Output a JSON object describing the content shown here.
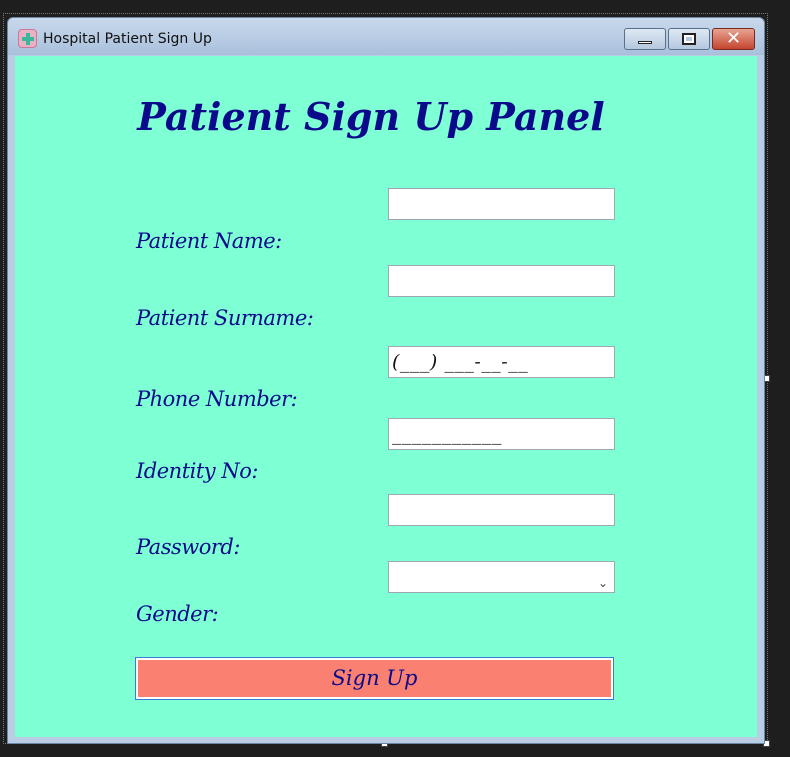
{
  "window": {
    "title": "Hospital Patient Sign Up",
    "icon": "hospital-icon"
  },
  "form": {
    "heading": "Patient Sign Up Panel",
    "fields": {
      "name_label": "Patient Name:",
      "name_value": "",
      "surname_label": "Patient Surname:",
      "surname_value": "",
      "phone_label": "Phone Number:",
      "phone_mask": "(___) ___-__-__",
      "identity_label": "Identity No:",
      "identity_mask": "___________",
      "password_label": "Password:",
      "password_value": "",
      "gender_label": "Gender:",
      "gender_value": ""
    },
    "submit_label": "Sign Up"
  },
  "colors": {
    "background": "#7fffd4",
    "label_text": "#0a0a8a",
    "button": "#fa8072"
  }
}
